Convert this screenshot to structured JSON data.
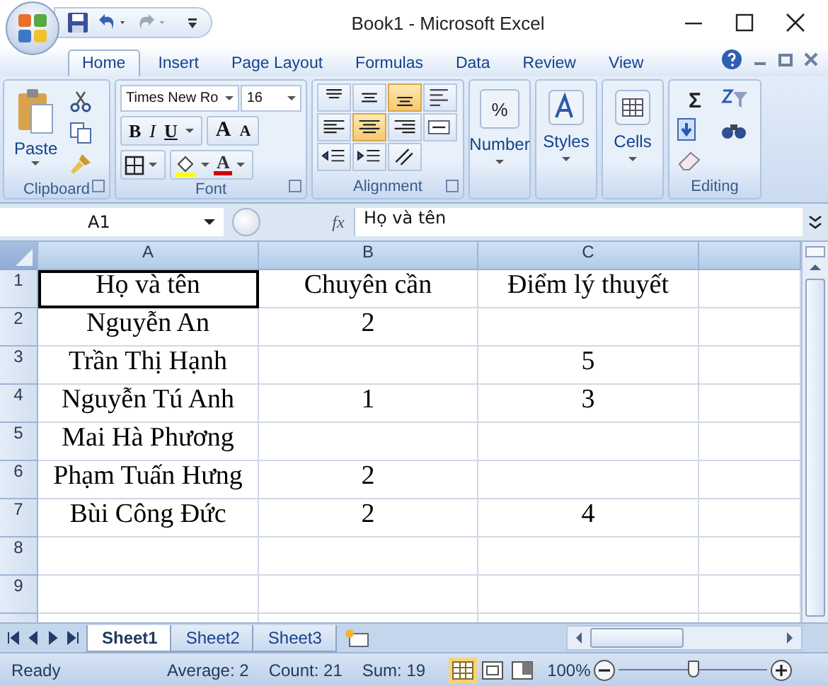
{
  "window": {
    "title": "Book1 - Microsoft Excel"
  },
  "ribbon_tabs": [
    {
      "label": "Home",
      "selected": true
    },
    {
      "label": "Insert",
      "selected": false
    },
    {
      "label": "Page Layout",
      "selected": false
    },
    {
      "label": "Formulas",
      "selected": false
    },
    {
      "label": "Data",
      "selected": false
    },
    {
      "label": "Review",
      "selected": false
    },
    {
      "label": "View",
      "selected": false
    }
  ],
  "ribbon": {
    "paste": "Paste",
    "font_name": "Times New Ro",
    "font_size": "16",
    "bold": "B",
    "italic": "I",
    "underline": "U",
    "grow_font": "A",
    "shrink_font": "A",
    "font_color": "A",
    "percent": "%",
    "number": "Number",
    "styles": "Styles",
    "cells": "Cells",
    "sum": "Σ",
    "groups": [
      "Clipboard",
      "Font",
      "Alignment",
      "Editing"
    ]
  },
  "formula_bar": {
    "name_box": "A1",
    "fx": "fx",
    "formula": "Họ và tên"
  },
  "columns": [
    "A",
    "B",
    "C"
  ],
  "rows": [
    {
      "number": "1",
      "cells": [
        {
          "text": "Họ và tên",
          "selected": true
        },
        {
          "text": "Chuyên cần",
          "selected": false
        },
        {
          "text": "Điểm lý thuyết",
          "selected": false
        }
      ]
    },
    {
      "number": "2",
      "cells": [
        {
          "text": "Nguyễn An",
          "selected": false
        },
        {
          "text": "2",
          "selected": false
        },
        {
          "selected": false
        }
      ]
    },
    {
      "number": "3",
      "cells": [
        {
          "text": "Trần Thị Hạnh",
          "selected": false
        },
        {
          "selected": false
        },
        {
          "text": "5",
          "selected": false
        }
      ]
    },
    {
      "number": "4",
      "cells": [
        {
          "text": "Nguyễn Tú Anh",
          "selected": false
        },
        {
          "text": "1",
          "selected": false
        },
        {
          "text": "3",
          "selected": false
        }
      ]
    },
    {
      "number": "5",
      "cells": [
        {
          "text": "Mai Hà Phương",
          "selected": false
        },
        {
          "selected": false
        },
        {
          "selected": false
        }
      ]
    },
    {
      "number": "6",
      "cells": [
        {
          "text": "Phạm Tuấn Hưng",
          "selected": false
        },
        {
          "text": "2",
          "selected": false
        },
        {
          "selected": false
        }
      ]
    },
    {
      "number": "7",
      "cells": [
        {
          "text": "Bùi Công Đức",
          "selected": false
        },
        {
          "text": "2",
          "selected": false
        },
        {
          "text": "4",
          "selected": false
        }
      ]
    },
    {
      "number": "8",
      "cells": [
        {
          "selected": false
        },
        {
          "selected": false
        },
        {
          "selected": false
        }
      ]
    },
    {
      "number": "9",
      "cells": [
        {
          "selected": false
        },
        {
          "selected": false
        },
        {
          "selected": false
        }
      ]
    }
  ],
  "sheet_tabs": [
    {
      "label": "Sheet1",
      "selected": true
    },
    {
      "label": "Sheet2",
      "selected": false
    },
    {
      "label": "Sheet3",
      "selected": false
    }
  ],
  "status_bar": {
    "state": "Ready",
    "average": "Average: 2",
    "count": "Count: 21",
    "sum": "Sum: 19",
    "zoom": "100%",
    "zoom_slider": {
      "level": 0.5
    }
  }
}
